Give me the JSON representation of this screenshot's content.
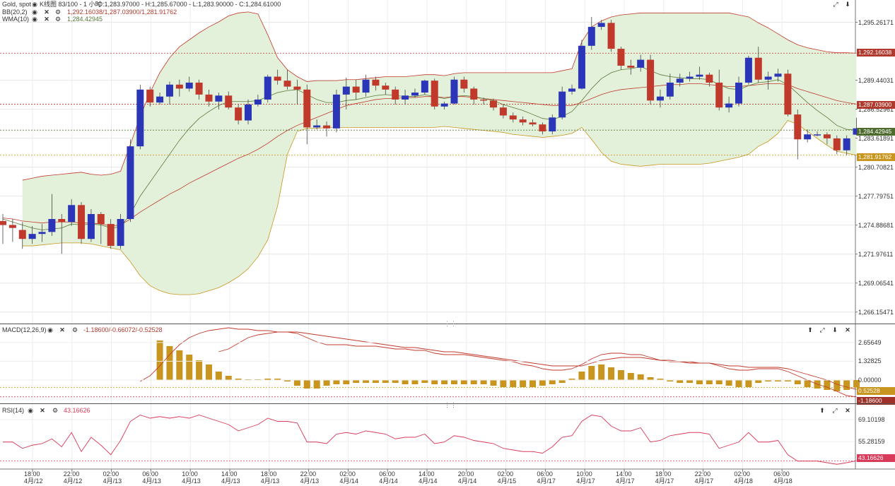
{
  "header": {
    "symbol": "Gold, spot",
    "chart_info": "K线图 83/100 - 1 小时",
    "ohlc": "O:1,283.97000 - H:1,285.67000 - L:1,283.90000 - C:1,284.61000",
    "bb_name": "BB(20,2)",
    "bb_values": "1,292.16038/1,287.03900/1,281.91762",
    "wma_name": "WMA(10)",
    "wma_value": "1,284.42945"
  },
  "macd_panel": {
    "name": "MACD(12,26,9)",
    "values": "-1.18600/-0.66072/-0.52528"
  },
  "rsi_panel": {
    "name": "RSI(14)",
    "value": "43.16626"
  },
  "price_axis": [
    "1,295.26171",
    "1,289.44031",
    "1,286.52961",
    "1,283.61891",
    "1,280.70821",
    "1,277.79751",
    "1,274.88681",
    "1,271.97611",
    "1,269.06541",
    "1,266.15471"
  ],
  "price_badges": {
    "bb_upper": "1,292.16038",
    "bb_mid": "1,287.03900",
    "wma": "1,284.42945",
    "bb_lower": "1,281.91762"
  },
  "macd_axis": [
    "2.65649",
    "1.32825",
    "0.00000"
  ],
  "macd_badges": {
    "signal": "0.52528",
    "macd": "-1.18600"
  },
  "rsi_axis": [
    "69.10198",
    "55.28159"
  ],
  "rsi_badge": "43.16626",
  "time_axis": [
    {
      "t": "18:00",
      "d": "4月/12"
    },
    {
      "t": "22:00",
      "d": "4月/12"
    },
    {
      "t": "02:00",
      "d": "4月/13"
    },
    {
      "t": "06:00",
      "d": "4月/13"
    },
    {
      "t": "10:00",
      "d": "4月/13"
    },
    {
      "t": "14:00",
      "d": "4月/13"
    },
    {
      "t": "18:00",
      "d": "4月/13"
    },
    {
      "t": "22:00",
      "d": "4月/13"
    },
    {
      "t": "02:00",
      "d": "4月/14"
    },
    {
      "t": "06:00",
      "d": "4月/14"
    },
    {
      "t": "14:00",
      "d": "4月/14"
    },
    {
      "t": "20:00",
      "d": "4月/14"
    },
    {
      "t": "02:00",
      "d": "4月/15"
    },
    {
      "t": "06:00",
      "d": "4月/17"
    },
    {
      "t": "10:00",
      "d": "4月/17"
    },
    {
      "t": "14:00",
      "d": "4月/17"
    },
    {
      "t": "18:00",
      "d": "4月/17"
    },
    {
      "t": "22:00",
      "d": "4月/17"
    },
    {
      "t": "02:00",
      "d": "4月/18"
    },
    {
      "t": "06:00",
      "d": "4月/18"
    }
  ],
  "colors": {
    "up": "#2b35b8",
    "down": "#c0392b",
    "band_fill": "#e3f1da",
    "band_line": "#c0392b",
    "wma": "#5a7a3a",
    "hist": "#c8961e",
    "rsi": "#d83a5a"
  },
  "chart_data": {
    "type": "candlestick",
    "price_range": [
      1265.0,
      1297.5
    ],
    "candles": [
      [
        1275.3,
        1274.9,
        1276.0,
        1273.0
      ],
      [
        1274.9,
        1274.6,
        1275.5,
        1273.2
      ],
      [
        1274.4,
        1273.5,
        1275.2,
        1272.5
      ],
      [
        1273.5,
        1274.0,
        1274.8,
        1273.0
      ],
      [
        1274.0,
        1274.2,
        1275.0,
        1273.2
      ],
      [
        1274.2,
        1275.5,
        1278.0,
        1273.8
      ],
      [
        1275.5,
        1275.2,
        1276.0,
        1272.0
      ],
      [
        1275.2,
        1276.9,
        1277.5,
        1274.8
      ],
      [
        1276.9,
        1273.5,
        1277.2,
        1273.0
      ],
      [
        1273.5,
        1276.0,
        1276.5,
        1273.2
      ],
      [
        1276.0,
        1275.0,
        1276.2,
        1273.0
      ],
      [
        1275.0,
        1272.8,
        1275.5,
        1272.5
      ],
      [
        1272.8,
        1275.5,
        1276.0,
        1272.5
      ],
      [
        1275.5,
        1282.8,
        1283.5,
        1275.2
      ],
      [
        1282.8,
        1288.5,
        1289.0,
        1282.5
      ],
      [
        1288.5,
        1287.2,
        1288.8,
        1286.8
      ],
      [
        1287.2,
        1287.8,
        1288.2,
        1287.0
      ],
      [
        1287.8,
        1289.0,
        1289.3,
        1287.0
      ],
      [
        1289.0,
        1288.6,
        1289.5,
        1287.8
      ],
      [
        1288.6,
        1289.2,
        1289.8,
        1288.3
      ],
      [
        1289.2,
        1288.0,
        1289.5,
        1287.5
      ],
      [
        1288.0,
        1287.3,
        1288.5,
        1286.8
      ],
      [
        1287.3,
        1287.9,
        1288.2,
        1286.5
      ],
      [
        1287.9,
        1286.7,
        1288.3,
        1286.5
      ],
      [
        1286.7,
        1285.4,
        1287.0,
        1285.0
      ],
      [
        1285.4,
        1287.0,
        1287.5,
        1285.0
      ],
      [
        1287.0,
        1287.5,
        1288.0,
        1286.8
      ],
      [
        1287.5,
        1289.8,
        1290.0,
        1287.2
      ],
      [
        1289.8,
        1289.4,
        1290.5,
        1289.0
      ],
      [
        1289.4,
        1288.8,
        1290.5,
        1288.5
      ],
      [
        1288.8,
        1288.5,
        1289.5,
        1287.0
      ],
      [
        1288.5,
        1284.7,
        1289.0,
        1283.0
      ],
      [
        1284.7,
        1284.9,
        1285.5,
        1284.5
      ],
      [
        1284.9,
        1284.6,
        1285.3,
        1283.8
      ],
      [
        1284.6,
        1288.0,
        1288.5,
        1284.2
      ],
      [
        1288.0,
        1288.8,
        1289.7,
        1286.5
      ],
      [
        1288.8,
        1288.2,
        1289.5,
        1287.5
      ],
      [
        1288.2,
        1289.5,
        1290.0,
        1287.8
      ],
      [
        1289.5,
        1288.9,
        1289.8,
        1288.4
      ],
      [
        1288.9,
        1288.5,
        1289.2,
        1288.0
      ],
      [
        1288.5,
        1287.5,
        1288.8,
        1287.0
      ],
      [
        1287.5,
        1287.9,
        1288.5,
        1287.0
      ],
      [
        1287.9,
        1288.2,
        1288.6,
        1287.7
      ],
      [
        1288.2,
        1289.4,
        1289.5,
        1288.0
      ],
      [
        1289.4,
        1286.8,
        1289.6,
        1286.5
      ],
      [
        1286.8,
        1287.1,
        1287.3,
        1286.5
      ],
      [
        1287.1,
        1289.5,
        1289.8,
        1287.0
      ],
      [
        1289.5,
        1288.6,
        1289.8,
        1288.2
      ],
      [
        1288.6,
        1287.5,
        1288.8,
        1287.0
      ],
      [
        1287.5,
        1287.4,
        1287.7,
        1287.0
      ],
      [
        1287.4,
        1286.7,
        1287.6,
        1286.4
      ],
      [
        1286.7,
        1285.9,
        1287.0,
        1285.6
      ],
      [
        1285.9,
        1285.5,
        1286.2,
        1285.2
      ],
      [
        1285.5,
        1285.2,
        1285.8,
        1284.9
      ],
      [
        1285.2,
        1285.0,
        1285.5,
        1284.8
      ],
      [
        1285.0,
        1284.3,
        1285.2,
        1284.0
      ],
      [
        1284.3,
        1285.7,
        1286.0,
        1284.0
      ],
      [
        1285.7,
        1288.3,
        1288.8,
        1285.5
      ],
      [
        1288.3,
        1288.6,
        1289.0,
        1288.0
      ],
      [
        1288.6,
        1292.9,
        1293.5,
        1288.5
      ],
      [
        1292.9,
        1294.8,
        1295.8,
        1292.5
      ],
      [
        1294.8,
        1295.2,
        1295.5,
        1294.5
      ],
      [
        1295.2,
        1292.6,
        1295.5,
        1292.3
      ],
      [
        1292.6,
        1290.9,
        1292.8,
        1290.5
      ],
      [
        1290.9,
        1290.7,
        1291.5,
        1290.0
      ],
      [
        1290.7,
        1291.5,
        1292.0,
        1290.3
      ],
      [
        1291.5,
        1287.4,
        1292.0,
        1287.0
      ],
      [
        1287.4,
        1287.8,
        1288.5,
        1286.7
      ],
      [
        1287.8,
        1289.2,
        1290.1,
        1287.5
      ],
      [
        1289.2,
        1289.6,
        1290.1,
        1288.8
      ],
      [
        1289.6,
        1289.8,
        1290.3,
        1289.3
      ],
      [
        1289.8,
        1290.0,
        1290.8,
        1289.5
      ],
      [
        1290.0,
        1289.2,
        1290.2,
        1288.8
      ],
      [
        1289.2,
        1286.7,
        1290.5,
        1286.4
      ],
      [
        1286.7,
        1287.1,
        1287.8,
        1286.2
      ],
      [
        1287.1,
        1289.2,
        1289.8,
        1286.8
      ],
      [
        1289.2,
        1291.7,
        1291.9,
        1289.0
      ],
      [
        1291.7,
        1289.5,
        1292.8,
        1289.2
      ],
      [
        1289.5,
        1289.8,
        1290.3,
        1288.5
      ],
      [
        1289.8,
        1290.1,
        1290.6,
        1289.3
      ],
      [
        1290.1,
        1286.0,
        1290.5,
        1285.8
      ],
      [
        1286.0,
        1283.5,
        1286.5,
        1281.5
      ],
      [
        1283.5,
        1284.0,
        1284.5,
        1283.2
      ],
      [
        1284.0,
        1284.0,
        1284.3,
        1283.8
      ],
      [
        1284.0,
        1283.6,
        1284.2,
        1283.0
      ],
      [
        1283.6,
        1282.4,
        1283.9,
        1282.0
      ],
      [
        1282.4,
        1283.6,
        1283.9,
        1281.9
      ],
      [
        1283.97,
        1284.61,
        1285.67,
        1283.9
      ]
    ],
    "bb_upper": [
      1278.6,
      1278.8,
      1279.4,
      1279.6,
      1279.8,
      1279.9,
      1280.0,
      1280.1,
      1280.2,
      1280.0,
      1279.9,
      1280.0,
      1280.3,
      1283.0,
      1285.8,
      1288.2,
      1290.2,
      1291.7,
      1292.8,
      1293.5,
      1294.2,
      1294.8,
      1295.3,
      1295.9,
      1296.2,
      1296.3,
      1296.1,
      1294.0,
      1291.7,
      1290.5,
      1289.8,
      1289.3,
      1289.4,
      1289.4,
      1289.4,
      1289.5,
      1289.5,
      1289.6,
      1289.7,
      1289.8,
      1289.8,
      1289.8,
      1289.9,
      1290.0,
      1290.0,
      1289.9,
      1290.1,
      1290.2,
      1290.2,
      1290.2,
      1290.2,
      1290.2,
      1290.2,
      1290.2,
      1290.2,
      1290.2,
      1290.2,
      1290.4,
      1290.6,
      1293.3,
      1294.8,
      1295.4,
      1295.8,
      1296.0,
      1296.1,
      1296.2,
      1296.2,
      1296.2,
      1296.2,
      1296.2,
      1296.2,
      1296.2,
      1296.2,
      1296.2,
      1296.2,
      1296.0,
      1295.8,
      1295.2,
      1294.7,
      1294.1,
      1293.5,
      1293.0,
      1292.7,
      1292.5,
      1292.3,
      1292.2,
      1292.2,
      1292.16
    ],
    "bb_mid": [
      1275.6,
      1275.5,
      1275.3,
      1275.2,
      1275.1,
      1275.2,
      1275.2,
      1275.2,
      1275.1,
      1275.1,
      1275.0,
      1274.8,
      1274.9,
      1275.5,
      1276.2,
      1276.8,
      1277.4,
      1278.0,
      1278.5,
      1279.1,
      1279.6,
      1280.1,
      1280.6,
      1281.1,
      1281.6,
      1282.0,
      1282.5,
      1283.1,
      1283.8,
      1284.4,
      1284.9,
      1285.3,
      1285.7,
      1286.1,
      1286.5,
      1286.9,
      1287.1,
      1287.3,
      1287.5,
      1287.6,
      1287.6,
      1287.7,
      1287.7,
      1287.8,
      1287.8,
      1287.7,
      1287.8,
      1287.8,
      1287.7,
      1287.6,
      1287.5,
      1287.4,
      1287.3,
      1287.2,
      1287.1,
      1287.0,
      1286.9,
      1286.9,
      1286.9,
      1287.2,
      1287.6,
      1288.0,
      1288.3,
      1288.5,
      1288.6,
      1288.7,
      1288.8,
      1288.9,
      1289.0,
      1289.0,
      1289.1,
      1289.1,
      1289.0,
      1288.9,
      1288.8,
      1288.8,
      1288.9,
      1289.0,
      1289.1,
      1289.1,
      1289.0,
      1288.6,
      1288.3,
      1288.0,
      1287.7,
      1287.4,
      1287.2,
      1287.04
    ],
    "bb_lower": [
      1272.6,
      1272.7,
      1272.8,
      1272.8,
      1272.9,
      1273.0,
      1273.1,
      1273.1,
      1273.1,
      1273.0,
      1272.8,
      1272.6,
      1272.4,
      1271.2,
      1269.8,
      1268.8,
      1268.3,
      1268.0,
      1267.9,
      1267.9,
      1268.0,
      1268.3,
      1268.6,
      1269.1,
      1269.7,
      1270.5,
      1271.7,
      1273.4,
      1276.8,
      1282.0,
      1284.3,
      1284.6,
      1284.6,
      1284.7,
      1284.7,
      1284.7,
      1284.7,
      1284.7,
      1284.7,
      1284.7,
      1284.7,
      1284.7,
      1284.7,
      1284.7,
      1284.7,
      1284.8,
      1284.7,
      1284.6,
      1284.5,
      1284.4,
      1284.3,
      1284.2,
      1284.0,
      1283.9,
      1283.8,
      1283.7,
      1283.8,
      1283.9,
      1284.1,
      1284.7,
      1283.5,
      1282.2,
      1281.3,
      1281.0,
      1280.9,
      1280.8,
      1280.9,
      1281.0,
      1281.0,
      1281.0,
      1281.0,
      1281.0,
      1281.1,
      1281.3,
      1281.5,
      1281.7,
      1282.0,
      1282.8,
      1283.3,
      1284.1,
      1285.4,
      1285.0,
      1284.3,
      1283.6,
      1282.9,
      1282.3,
      1282.1,
      1281.92
    ],
    "wma": [
      1275.5,
      1275.2,
      1274.9,
      1274.6,
      1274.4,
      1274.5,
      1274.6,
      1275.0,
      1274.9,
      1275.0,
      1274.9,
      1274.6,
      1274.7,
      1276.0,
      1277.8,
      1279.2,
      1280.6,
      1282.0,
      1283.4,
      1284.6,
      1285.6,
      1286.3,
      1286.9,
      1287.3,
      1287.3,
      1287.3,
      1287.4,
      1287.8,
      1288.2,
      1288.4,
      1288.5,
      1288.0,
      1287.5,
      1287.2,
      1287.2,
      1287.4,
      1287.5,
      1287.7,
      1287.9,
      1288.0,
      1287.9,
      1287.8,
      1287.8,
      1288.0,
      1287.8,
      1287.6,
      1287.8,
      1287.9,
      1287.8,
      1287.6,
      1287.4,
      1287.0,
      1286.7,
      1286.4,
      1286.0,
      1285.6,
      1285.5,
      1285.8,
      1286.3,
      1287.4,
      1288.6,
      1289.6,
      1290.2,
      1290.5,
      1290.6,
      1290.8,
      1290.4,
      1290.0,
      1289.8,
      1289.7,
      1289.6,
      1289.6,
      1289.5,
      1289.0,
      1288.6,
      1288.5,
      1288.9,
      1289.2,
      1289.3,
      1289.5,
      1289.0,
      1288.1,
      1287.2,
      1286.4,
      1285.7,
      1284.9,
      1284.5,
      1284.43
    ],
    "macd_range": [
      -1.6,
      3.9
    ],
    "macd_line": [
      null,
      null,
      null,
      null,
      null,
      null,
      null,
      null,
      null,
      null,
      null,
      null,
      null,
      null,
      -0.1,
      0.3,
      1.0,
      1.8,
      2.5,
      3.0,
      3.3,
      3.5,
      3.6,
      3.7,
      3.6,
      3.6,
      3.5,
      3.5,
      3.4,
      3.4,
      3.3,
      3.0,
      2.7,
      2.5,
      2.5,
      2.5,
      2.4,
      2.4,
      2.4,
      2.3,
      2.2,
      2.2,
      2.1,
      2.1,
      1.9,
      1.8,
      1.8,
      1.8,
      1.7,
      1.6,
      1.5,
      1.4,
      1.3,
      1.1,
      1.0,
      0.8,
      0.7,
      0.7,
      0.8,
      1.1,
      1.5,
      1.8,
      1.9,
      1.9,
      1.8,
      1.8,
      1.6,
      1.4,
      1.3,
      1.3,
      1.2,
      1.2,
      1.2,
      1.0,
      0.8,
      0.7,
      0.7,
      0.8,
      0.8,
      0.8,
      0.6,
      0.3,
      0.0,
      -0.3,
      -0.5,
      -0.8,
      -1.1,
      -1.19
    ],
    "macd_signal": [
      null,
      null,
      null,
      null,
      null,
      null,
      null,
      null,
      null,
      null,
      null,
      null,
      null,
      null,
      null,
      null,
      null,
      null,
      null,
      null,
      null,
      null,
      2.0,
      2.2,
      2.6,
      3.0,
      3.2,
      3.3,
      3.4,
      3.4,
      3.4,
      3.3,
      3.2,
      3.1,
      3.0,
      2.9,
      2.8,
      2.7,
      2.6,
      2.5,
      2.4,
      2.3,
      2.3,
      2.2,
      2.1,
      2.0,
      2.0,
      1.9,
      1.8,
      1.7,
      1.6,
      1.5,
      1.4,
      1.3,
      1.2,
      1.1,
      1.0,
      1.0,
      1.0,
      1.0,
      1.2,
      1.4,
      1.5,
      1.6,
      1.6,
      1.6,
      1.5,
      1.4,
      1.4,
      1.3,
      1.3,
      1.2,
      1.2,
      1.1,
      1.0,
      1.0,
      0.9,
      0.9,
      0.9,
      0.9,
      0.8,
      0.6,
      0.4,
      0.2,
      0.0,
      -0.3,
      -0.5,
      -0.66
    ],
    "macd_hist": [
      null,
      null,
      null,
      null,
      null,
      null,
      null,
      null,
      null,
      null,
      null,
      null,
      null,
      null,
      null,
      null,
      2.8,
      2.4,
      2.1,
      1.8,
      1.4,
      1.1,
      0.6,
      0.3,
      0.1,
      0.05,
      0.05,
      0.1,
      0.1,
      -0.1,
      -0.4,
      -0.6,
      -0.6,
      -0.4,
      -0.3,
      -0.3,
      -0.2,
      -0.2,
      -0.2,
      -0.2,
      -0.2,
      -0.3,
      -0.3,
      -0.2,
      -0.3,
      -0.3,
      -0.3,
      -0.3,
      -0.3,
      -0.3,
      -0.4,
      -0.5,
      -0.5,
      -0.5,
      -0.5,
      -0.4,
      -0.3,
      -0.2,
      0.1,
      0.6,
      1.0,
      1.1,
      0.9,
      0.7,
      0.5,
      0.4,
      0.2,
      0.1,
      -0.1,
      -0.2,
      -0.2,
      -0.3,
      -0.3,
      -0.3,
      -0.4,
      -0.5,
      -0.5,
      -0.2,
      -0.1,
      -0.1,
      -0.1,
      -0.3,
      -0.5,
      -0.6,
      -0.7,
      -0.8,
      -0.7,
      -0.53
    ],
    "rsi_range": [
      38,
      78
    ],
    "rsi": [
      55,
      55,
      51,
      53,
      54,
      57,
      52,
      61,
      49,
      58,
      53,
      47,
      56,
      68,
      72,
      70,
      71,
      70,
      71,
      70,
      72,
      70,
      68,
      66,
      62,
      64,
      66,
      70,
      68,
      68,
      67,
      55,
      55,
      54,
      60,
      61,
      60,
      62,
      61,
      60,
      57,
      58,
      58,
      60,
      54,
      55,
      59,
      58,
      56,
      55,
      54,
      51,
      50,
      49,
      49,
      48,
      52,
      58,
      59,
      68,
      72,
      71,
      65,
      62,
      62,
      64,
      55,
      56,
      59,
      60,
      61,
      61,
      60,
      51,
      53,
      55,
      61,
      55,
      55,
      56,
      47,
      43,
      43,
      43,
      42,
      41,
      42,
      43.17
    ]
  }
}
